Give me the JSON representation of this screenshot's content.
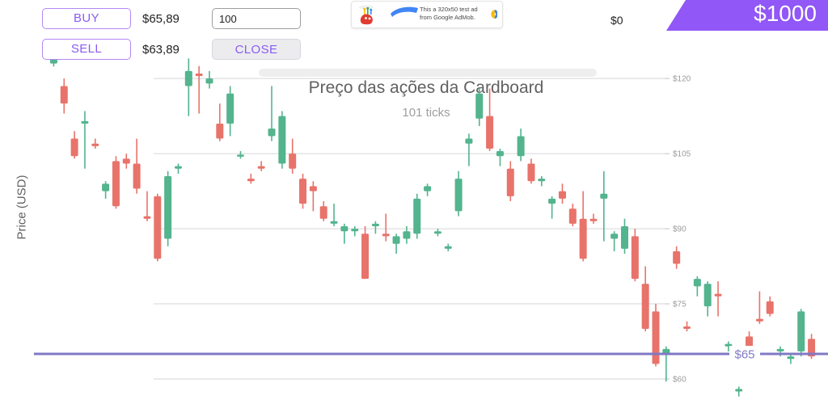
{
  "toolbar": {
    "buy_label": "BUY",
    "buy_price": "$65,89",
    "sell_label": "SELL",
    "sell_price": "$63,89",
    "quantity_value": "100",
    "quantity_placeholder": "100",
    "close_label": "CLOSE"
  },
  "ad": {
    "line1": "This a 320x50 test ad",
    "line2": "from Google AdMob."
  },
  "balance": {
    "amount": "$1000",
    "zero_label": "$0"
  },
  "chart_data": {
    "type": "candlestick",
    "title": "Preço das ações da Cardboard",
    "subtitle": "101 ticks",
    "ylabel": "Price (USD)",
    "xlabel": "",
    "grid": true,
    "legend": null,
    "ylim": [
      55,
      126
    ],
    "yticks": [
      60,
      75,
      90,
      105,
      120
    ],
    "ytick_labels": [
      "$60",
      "$75",
      "$90",
      "$105",
      "$120"
    ],
    "up_color": "#53b48e",
    "down_color": "#e8736a",
    "marker_line": {
      "value": 65,
      "label": "$65",
      "color": "#8079c4"
    },
    "candles": [
      {
        "i": 0,
        "o": 123.0,
        "h": 124.5,
        "l": 122.4,
        "c": 124.0
      },
      {
        "i": 1,
        "o": 118.5,
        "h": 120.0,
        "l": 113.0,
        "c": 115.0
      },
      {
        "i": 2,
        "o": 108.0,
        "h": 109.5,
        "l": 104.0,
        "c": 104.5
      },
      {
        "i": 3,
        "o": 111.0,
        "h": 113.5,
        "l": 102.0,
        "c": 111.5
      },
      {
        "i": 4,
        "o": 107.0,
        "h": 108.0,
        "l": 106.0,
        "c": 106.5
      },
      {
        "i": 5,
        "o": 97.5,
        "h": 99.5,
        "l": 96.0,
        "c": 99.0
      },
      {
        "i": 6,
        "o": 103.5,
        "h": 104.5,
        "l": 94.0,
        "c": 94.5
      },
      {
        "i": 7,
        "o": 104.0,
        "h": 105.0,
        "l": 102.0,
        "c": 103.0
      },
      {
        "i": 8,
        "o": 103.0,
        "h": 108.0,
        "l": 97.0,
        "c": 98.0
      },
      {
        "i": 9,
        "o": 92.5,
        "h": 97.5,
        "l": 91.5,
        "c": 92.0
      },
      {
        "i": 10,
        "o": 96.5,
        "h": 97.0,
        "l": 83.5,
        "c": 84.0
      },
      {
        "i": 11,
        "o": 88.0,
        "h": 101.5,
        "l": 86.5,
        "c": 100.5
      },
      {
        "i": 12,
        "o": 102.0,
        "h": 103.0,
        "l": 101.0,
        "c": 102.5
      },
      {
        "i": 13,
        "o": 118.5,
        "h": 124.0,
        "l": 112.5,
        "c": 121.5
      },
      {
        "i": 14,
        "o": 121.0,
        "h": 122.5,
        "l": 113.0,
        "c": 120.5
      },
      {
        "i": 15,
        "o": 119.0,
        "h": 121.5,
        "l": 118.0,
        "c": 120.0
      },
      {
        "i": 16,
        "o": 111.0,
        "h": 115.0,
        "l": 107.5,
        "c": 108.0
      },
      {
        "i": 17,
        "o": 111.0,
        "h": 118.5,
        "l": 108.5,
        "c": 117.0
      },
      {
        "i": 18,
        "o": 104.5,
        "h": 105.5,
        "l": 104.0,
        "c": 104.8
      },
      {
        "i": 19,
        "o": 100.0,
        "h": 101.0,
        "l": 99.0,
        "c": 99.5
      },
      {
        "i": 20,
        "o": 102.5,
        "h": 103.5,
        "l": 101.5,
        "c": 102.0
      },
      {
        "i": 21,
        "o": 108.5,
        "h": 118.5,
        "l": 107.5,
        "c": 110.0
      },
      {
        "i": 22,
        "o": 103.0,
        "h": 113.5,
        "l": 102.0,
        "c": 112.5
      },
      {
        "i": 23,
        "o": 105.0,
        "h": 108.0,
        "l": 101.0,
        "c": 102.0
      },
      {
        "i": 24,
        "o": 100.0,
        "h": 101.0,
        "l": 94.0,
        "c": 95.0
      },
      {
        "i": 25,
        "o": 98.5,
        "h": 99.5,
        "l": 93.5,
        "c": 97.5
      },
      {
        "i": 26,
        "o": 94.5,
        "h": 95.5,
        "l": 91.5,
        "c": 92.0
      },
      {
        "i": 27,
        "o": 91.0,
        "h": 95.0,
        "l": 90.5,
        "c": 91.5
      },
      {
        "i": 28,
        "o": 89.5,
        "h": 91.0,
        "l": 87.0,
        "c": 90.5
      },
      {
        "i": 29,
        "o": 89.5,
        "h": 90.5,
        "l": 88.5,
        "c": 90.0
      },
      {
        "i": 30,
        "o": 89.0,
        "h": 90.5,
        "l": 80.5,
        "c": 80.0
      },
      {
        "i": 31,
        "o": 90.5,
        "h": 91.5,
        "l": 89.0,
        "c": 91.0
      },
      {
        "i": 32,
        "o": 89.0,
        "h": 93.0,
        "l": 87.5,
        "c": 88.5
      },
      {
        "i": 33,
        "o": 87.0,
        "h": 89.0,
        "l": 85.0,
        "c": 88.5
      },
      {
        "i": 34,
        "o": 88.0,
        "h": 90.5,
        "l": 87.0,
        "c": 89.5
      },
      {
        "i": 35,
        "o": 89.0,
        "h": 97.0,
        "l": 88.0,
        "c": 96.0
      },
      {
        "i": 36,
        "o": 97.5,
        "h": 99.0,
        "l": 96.5,
        "c": 98.5
      },
      {
        "i": 37,
        "o": 89.0,
        "h": 90.0,
        "l": 88.5,
        "c": 89.5
      },
      {
        "i": 38,
        "o": 86.0,
        "h": 87.0,
        "l": 85.5,
        "c": 86.5
      },
      {
        "i": 39,
        "o": 93.5,
        "h": 101.5,
        "l": 92.5,
        "c": 100.0
      },
      {
        "i": 40,
        "o": 107.0,
        "h": 109.0,
        "l": 102.5,
        "c": 108.0
      },
      {
        "i": 41,
        "o": 112.0,
        "h": 118.0,
        "l": 110.5,
        "c": 117.0
      },
      {
        "i": 42,
        "o": 112.5,
        "h": 118.0,
        "l": 105.5,
        "c": 106.0
      },
      {
        "i": 43,
        "o": 104.5,
        "h": 106.0,
        "l": 102.5,
        "c": 105.5
      },
      {
        "i": 44,
        "o": 102.0,
        "h": 103.5,
        "l": 95.5,
        "c": 96.5
      },
      {
        "i": 45,
        "o": 104.5,
        "h": 110.0,
        "l": 103.5,
        "c": 108.5
      },
      {
        "i": 46,
        "o": 103.0,
        "h": 104.0,
        "l": 99.0,
        "c": 99.5
      },
      {
        "i": 47,
        "o": 99.5,
        "h": 100.5,
        "l": 98.5,
        "c": 100.0
      },
      {
        "i": 48,
        "o": 95.0,
        "h": 96.5,
        "l": 92.0,
        "c": 96.0
      },
      {
        "i": 49,
        "o": 97.5,
        "h": 99.0,
        "l": 95.0,
        "c": 96.0
      },
      {
        "i": 50,
        "o": 94.0,
        "h": 95.0,
        "l": 90.5,
        "c": 91.0
      },
      {
        "i": 51,
        "o": 92.0,
        "h": 97.5,
        "l": 83.5,
        "c": 84.0
      },
      {
        "i": 52,
        "o": 92.0,
        "h": 93.0,
        "l": 91.0,
        "c": 91.5
      },
      {
        "i": 53,
        "o": 96.0,
        "h": 101.5,
        "l": 87.5,
        "c": 97.0
      },
      {
        "i": 54,
        "o": 88.0,
        "h": 89.5,
        "l": 85.5,
        "c": 89.0
      },
      {
        "i": 55,
        "o": 86.0,
        "h": 92.0,
        "l": 85.0,
        "c": 90.5
      },
      {
        "i": 56,
        "o": 88.5,
        "h": 90.0,
        "l": 79.5,
        "c": 80.0
      },
      {
        "i": 57,
        "o": 79.0,
        "h": 82.5,
        "l": 69.5,
        "c": 70.0
      },
      {
        "i": 58,
        "o": 73.5,
        "h": 75.0,
        "l": 62.5,
        "c": 63.0
      },
      {
        "i": 59,
        "o": 65.0,
        "h": 66.5,
        "l": 59.5,
        "c": 66.0
      },
      {
        "i": 60,
        "o": 85.5,
        "h": 86.5,
        "l": 82.0,
        "c": 83.0
      },
      {
        "i": 61,
        "o": 70.5,
        "h": 71.5,
        "l": 69.5,
        "c": 70.0
      },
      {
        "i": 62,
        "o": 78.5,
        "h": 80.5,
        "l": 76.5,
        "c": 80.0
      },
      {
        "i": 63,
        "o": 74.5,
        "h": 79.5,
        "l": 72.5,
        "c": 79.0
      },
      {
        "i": 64,
        "o": 77.0,
        "h": 79.5,
        "l": 72.5,
        "c": 76.5
      },
      {
        "i": 65,
        "o": 66.5,
        "h": 67.5,
        "l": 65.5,
        "c": 67.0
      },
      {
        "i": 66,
        "o": 57.5,
        "h": 58.5,
        "l": 56.5,
        "c": 58.0
      },
      {
        "i": 67,
        "o": 68.5,
        "h": 69.5,
        "l": 63.5,
        "c": 64.0
      },
      {
        "i": 68,
        "o": 72.0,
        "h": 77.5,
        "l": 71.0,
        "c": 71.5
      },
      {
        "i": 69,
        "o": 75.5,
        "h": 76.5,
        "l": 72.5,
        "c": 73.0
      },
      {
        "i": 70,
        "o": 65.5,
        "h": 66.5,
        "l": 64.5,
        "c": 66.0
      },
      {
        "i": 71,
        "o": 64.0,
        "h": 65.0,
        "l": 63.0,
        "c": 64.5
      },
      {
        "i": 72,
        "o": 65.5,
        "h": 74.0,
        "l": 64.5,
        "c": 73.5
      },
      {
        "i": 73,
        "o": 68.0,
        "h": 69.0,
        "l": 64.0,
        "c": 64.5
      }
    ]
  }
}
